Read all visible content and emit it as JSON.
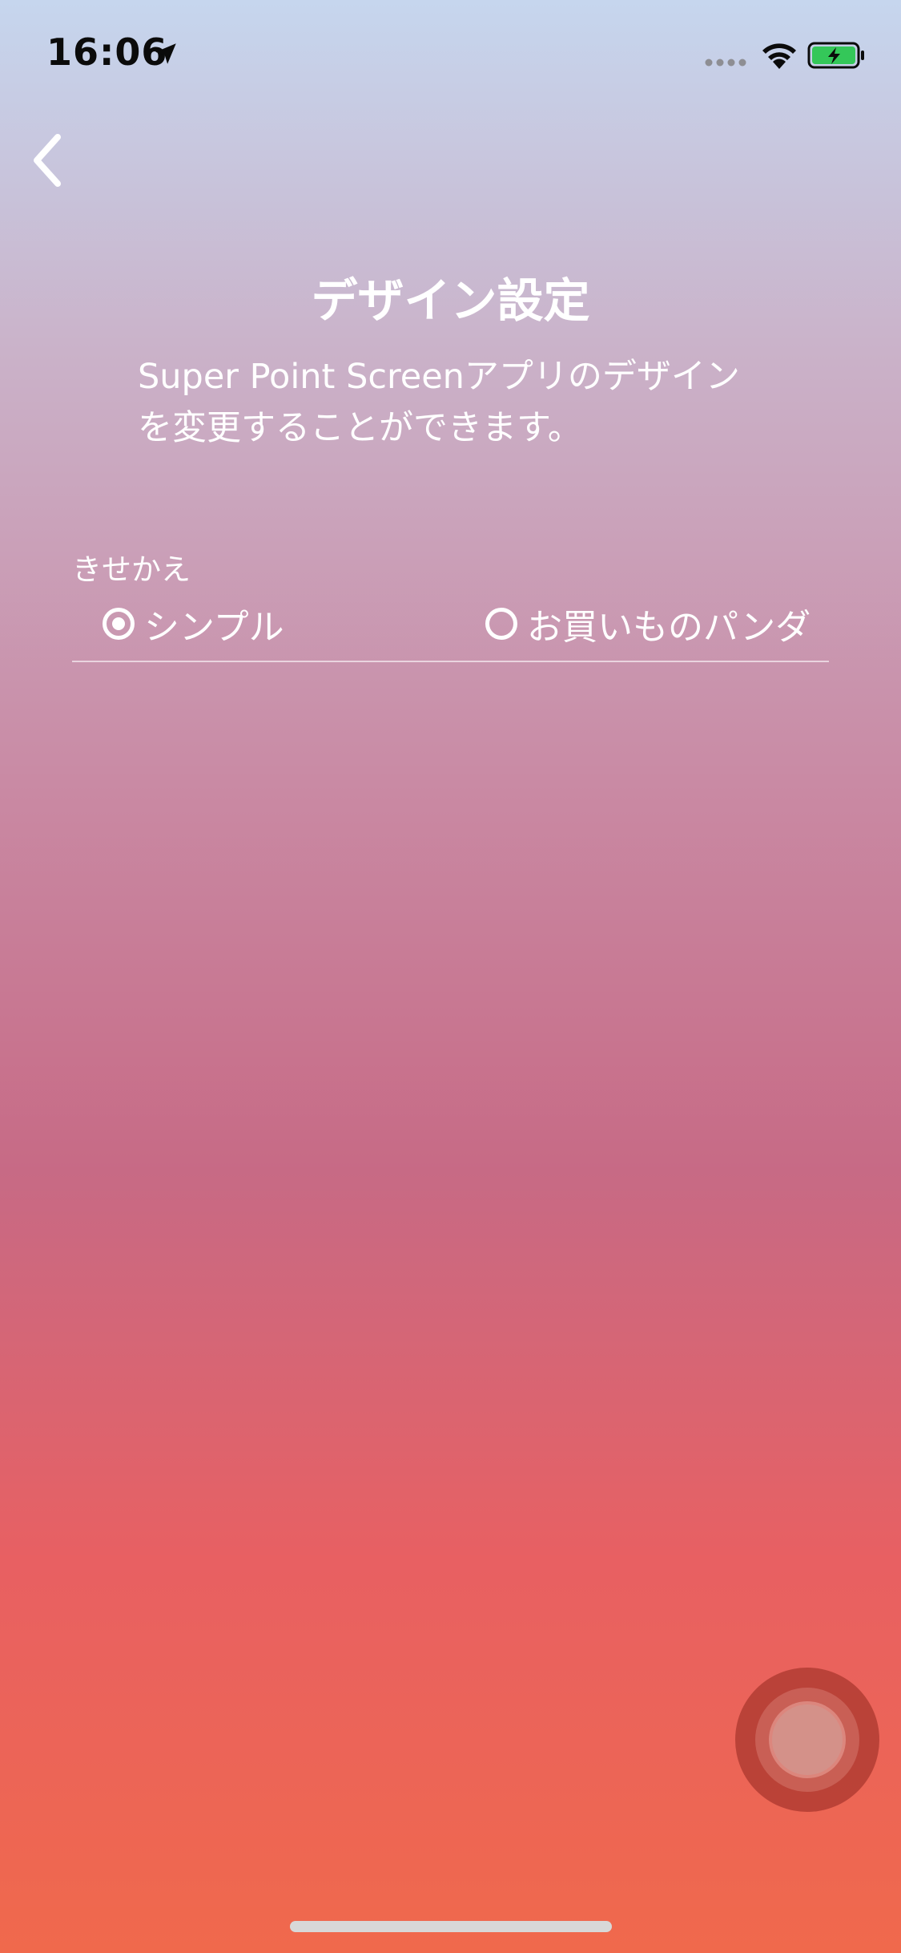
{
  "status_bar": {
    "time": "16:06",
    "icons": [
      "location-arrow-icon",
      "cellular-signal-icon",
      "wifi-icon",
      "battery-charging-icon"
    ],
    "battery_color": "#34c759"
  },
  "nav": {
    "back_icon": "chevron-left-icon"
  },
  "header": {
    "title": "デザイン設定",
    "description_line1": "Super Point Screenアプリのデザイン",
    "description_line2": "を変更することができます。"
  },
  "theme_section": {
    "label": "きせかえ",
    "options": [
      {
        "label": "シンプル",
        "selected": true
      },
      {
        "label": "お買いものパンダ",
        "selected": false
      }
    ]
  },
  "assistive_touch": {
    "icon": "assistive-touch-icon"
  }
}
